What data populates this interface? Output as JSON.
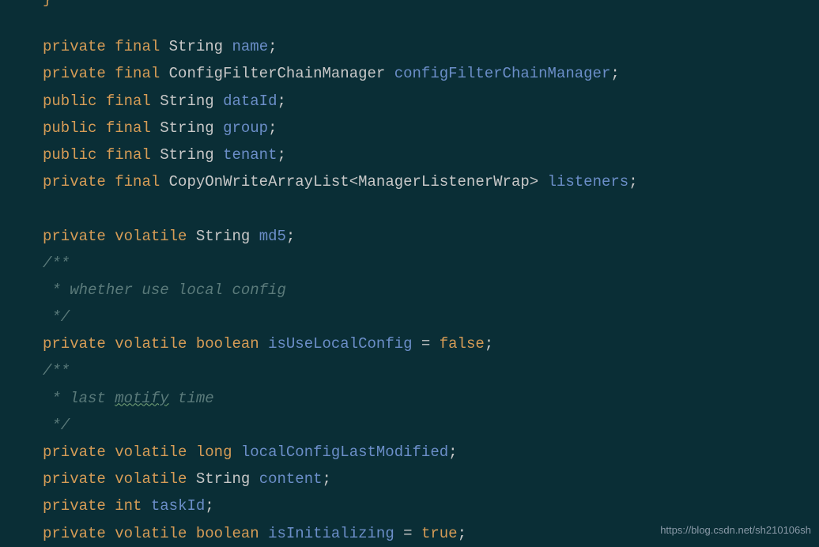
{
  "top_fragment": "}",
  "lines": {
    "l1": {
      "kw1": "private",
      "kw2": "final",
      "type": "String",
      "ident": "name",
      "semi": ";"
    },
    "l2": {
      "kw1": "private",
      "kw2": "final",
      "type": "ConfigFilterChainManager",
      "ident": "configFilterChainManager",
      "semi": ";"
    },
    "l3": {
      "kw1": "public",
      "kw2": "final",
      "type": "String",
      "ident": "dataId",
      "semi": ";"
    },
    "l4": {
      "kw1": "public",
      "kw2": "final",
      "type": "String",
      "ident": "group",
      "semi": ";"
    },
    "l5": {
      "kw1": "public",
      "kw2": "final",
      "type": "String",
      "ident": "tenant",
      "semi": ";"
    },
    "l6": {
      "kw1": "private",
      "kw2": "final",
      "type1": "CopyOnWriteArrayList",
      "lt": "<",
      "type2": "ManagerListenerWrap",
      "gt": ">",
      "ident": "listeners",
      "semi": ";"
    },
    "l7": {
      "kw1": "private",
      "kw2": "volatile",
      "type": "String",
      "ident": "md5",
      "semi": ";"
    },
    "c1_open": "/**",
    "c1_body": " * whether use local config",
    "c1_close": " */",
    "l8": {
      "kw1": "private",
      "kw2": "volatile",
      "type": "boolean",
      "ident": "isUseLocalConfig",
      "eq": " = ",
      "val": "false",
      "semi": ";"
    },
    "c2_open": "/**",
    "c2_body_pre": " * last ",
    "c2_body_wavy": "motify",
    "c2_body_post": " time",
    "c2_close": " */",
    "l9": {
      "kw1": "private",
      "kw2": "volatile",
      "type": "long",
      "ident": "localConfigLastModified",
      "semi": ";"
    },
    "l10": {
      "kw1": "private",
      "kw2": "volatile",
      "type": "String",
      "ident": "content",
      "semi": ";"
    },
    "l11": {
      "kw1": "private",
      "kw2": "int",
      "ident": "taskId",
      "semi": ";"
    },
    "l12": {
      "kw1": "private",
      "kw2": "volatile",
      "type": "boolean",
      "ident": "isInitializing",
      "eq": " = ",
      "val": "true",
      "semi": ";"
    }
  },
  "watermark": "https://blog.csdn.net/sh210106sh"
}
